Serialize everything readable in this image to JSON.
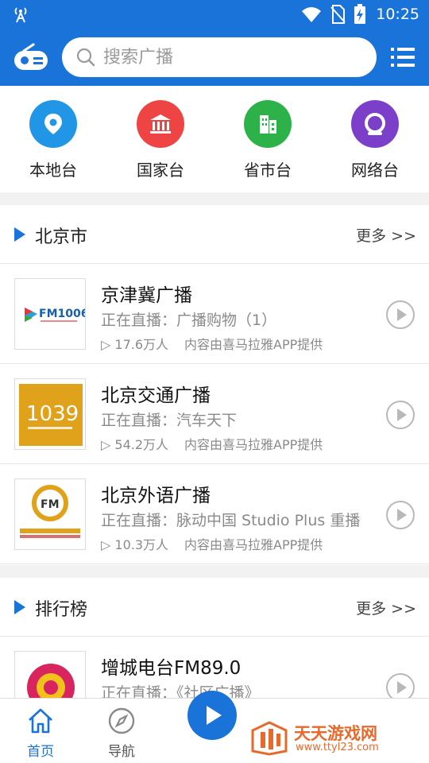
{
  "status_bar": {
    "time": "10:25"
  },
  "search": {
    "placeholder": "搜索广播"
  },
  "categories": [
    {
      "label": "本地台",
      "color": "#2196e6",
      "icon": "location-pin-icon"
    },
    {
      "label": "国家台",
      "color": "#ef4444",
      "icon": "bank-icon"
    },
    {
      "label": "省市台",
      "color": "#2db24a",
      "icon": "building-icon"
    },
    {
      "label": "网络台",
      "color": "#7b3fc9",
      "icon": "globe-q-icon"
    }
  ],
  "local_section": {
    "title": "北京市",
    "more": "更多 >>",
    "items": [
      {
        "title": "京津冀广播",
        "live": "正在直播：广播购物（1）",
        "count": "▷ 17.6万人",
        "source": "内容由喜马拉雅APP提供",
        "logo_text": "FM1006"
      },
      {
        "title": "北京交通广播",
        "live": "正在直播：汽车天下",
        "count": "▷ 54.2万人",
        "source": "内容由喜马拉雅APP提供",
        "logo_text": "1039"
      },
      {
        "title": "北京外语广播",
        "live": "正在直播：脉动中国 Studio Plus 重播",
        "count": "▷ 10.3万人",
        "source": "内容由喜马拉雅APP提供",
        "logo_text": "FM"
      }
    ]
  },
  "ranking_section": {
    "title": "排行榜",
    "more": "更多 >>",
    "items": [
      {
        "title": "增城电台FM89.0",
        "live": "正在直播：《社区广播》"
      }
    ]
  },
  "bottom_nav": {
    "home": "首页",
    "nav": "导航"
  },
  "watermark": {
    "title": "天天游戏网",
    "url": "www.ttyl23.com"
  },
  "colors": {
    "primary": "#1a73d9",
    "watermark": "#e8692c"
  }
}
